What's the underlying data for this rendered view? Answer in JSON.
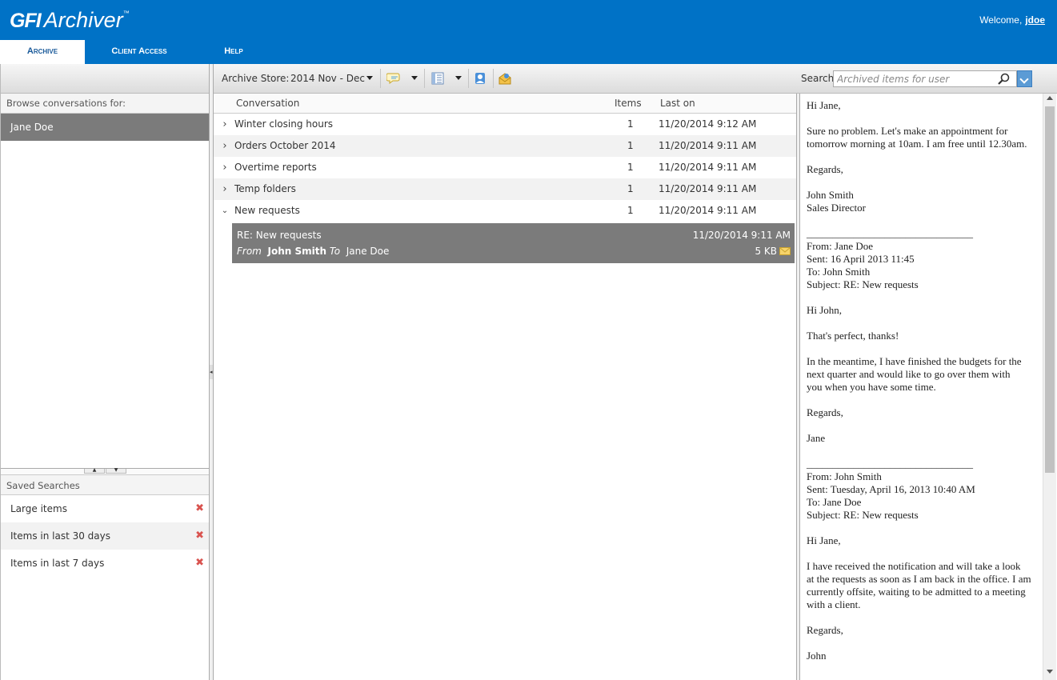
{
  "app": {
    "logo_brand": "GFI",
    "logo_product": "Archiver",
    "logo_tm": "™",
    "welcome_text": "Welcome,",
    "username": "jdoe"
  },
  "tabs": [
    {
      "label": "Archive",
      "active": true
    },
    {
      "label": "Client Access",
      "active": false
    },
    {
      "label": "Help",
      "active": false
    }
  ],
  "left": {
    "browse_header": "Browse conversations for:",
    "selected_user": "Jane Doe",
    "saved_header": "Saved Searches",
    "saved_searches": [
      {
        "label": "Large items"
      },
      {
        "label": "Items in last 30 days"
      },
      {
        "label": "Items in last 7 days"
      }
    ]
  },
  "toolbar": {
    "store_label": "Archive Store:",
    "store_value": "2014 Nov - Dec",
    "search_label": "Search:",
    "search_placeholder": "Archived items for user"
  },
  "conversations": {
    "columns": {
      "conversation": "Conversation",
      "items": "Items",
      "last_on": "Last on"
    },
    "rows": [
      {
        "chevron": ">",
        "subject": "Winter closing hours",
        "items": "1",
        "last_on": "11/20/2014 9:12 AM"
      },
      {
        "chevron": ">",
        "subject": "Orders October 2014",
        "items": "1",
        "last_on": "11/20/2014 9:11 AM"
      },
      {
        "chevron": ">",
        "subject": "Overtime reports",
        "items": "1",
        "last_on": "11/20/2014 9:11 AM"
      },
      {
        "chevron": ">",
        "subject": "Temp folders",
        "items": "1",
        "last_on": "11/20/2014 9:11 AM"
      },
      {
        "chevron": "v",
        "subject": "New requests",
        "items": "1",
        "last_on": "11/20/2014 9:11 AM"
      }
    ],
    "selected_message": {
      "subject": "RE: New requests",
      "date": "11/20/2014 9:11 AM",
      "from_label": "From",
      "from": "John Smith",
      "to_label": "To",
      "to": "Jane Doe",
      "size": "5 KB"
    }
  },
  "preview": {
    "body": "Hi Jane,\n\nSure no problem. Let's make an appointment for\ntomorrow morning at 10am. I am free until 12.30am.\n\nRegards,\n\nJohn Smith\nSales Director\n\n________________________________\nFrom: Jane Doe\nSent: 16 April 2013 11:45\nTo: John Smith\nSubject: RE: New requests\n\nHi John,\n\nThat's perfect, thanks!\n\nIn the meantime, I have finished the budgets for the\nnext quarter and would like to go over them with\nyou when you have some time.\n\nRegards,\n\nJane\n\n________________________________\nFrom: John Smith\nSent: Tuesday, April 16, 2013 10:40 AM\nTo: Jane Doe\nSubject: RE: New requests\n\nHi Jane,\n\nI have received the notification and will take a look\nat the requests as soon as I am back in the office. I am\ncurrently offsite, waiting to be admitted to a meeting\nwith a client.\n\nRegards,\n\nJohn"
  },
  "colors": {
    "header_blue": "#0072c6",
    "selected_gray": "#7b7b7b",
    "delete_red": "#d9534f"
  }
}
